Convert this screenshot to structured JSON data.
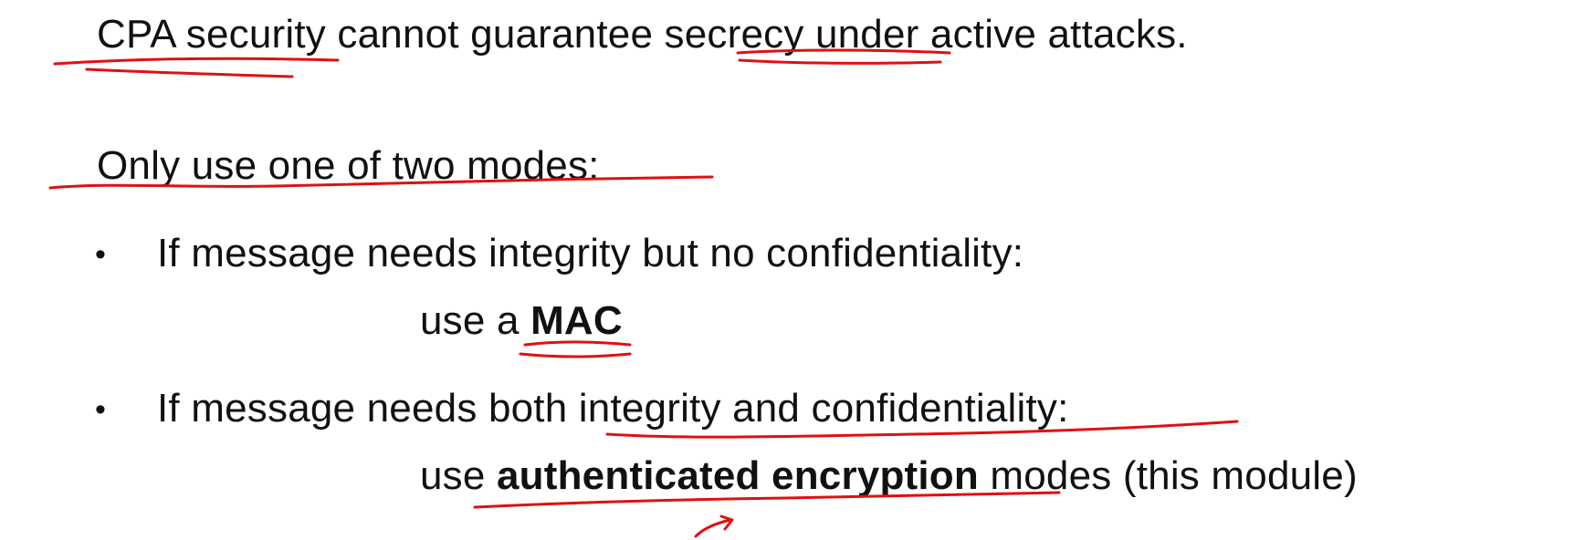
{
  "slide": {
    "line1": {
      "part1": "CPA security cannot guarantee secrecy under active attacks."
    },
    "line2": "Only use one of two modes:",
    "bullets": [
      {
        "marker": "•",
        "text": "If message needs integrity but no confidentiality:",
        "sub_prefix": "use a ",
        "sub_bold": "MAC",
        "sub_suffix": ""
      },
      {
        "marker": "•",
        "text": "If message needs both integrity and confidentiality:",
        "sub_prefix": "use ",
        "sub_bold": "authenticated encryption",
        "sub_suffix": " modes (this module)"
      }
    ]
  },
  "colors": {
    "text": "#111111",
    "annotation_ink": "#e01010",
    "background": "#ffffff"
  }
}
